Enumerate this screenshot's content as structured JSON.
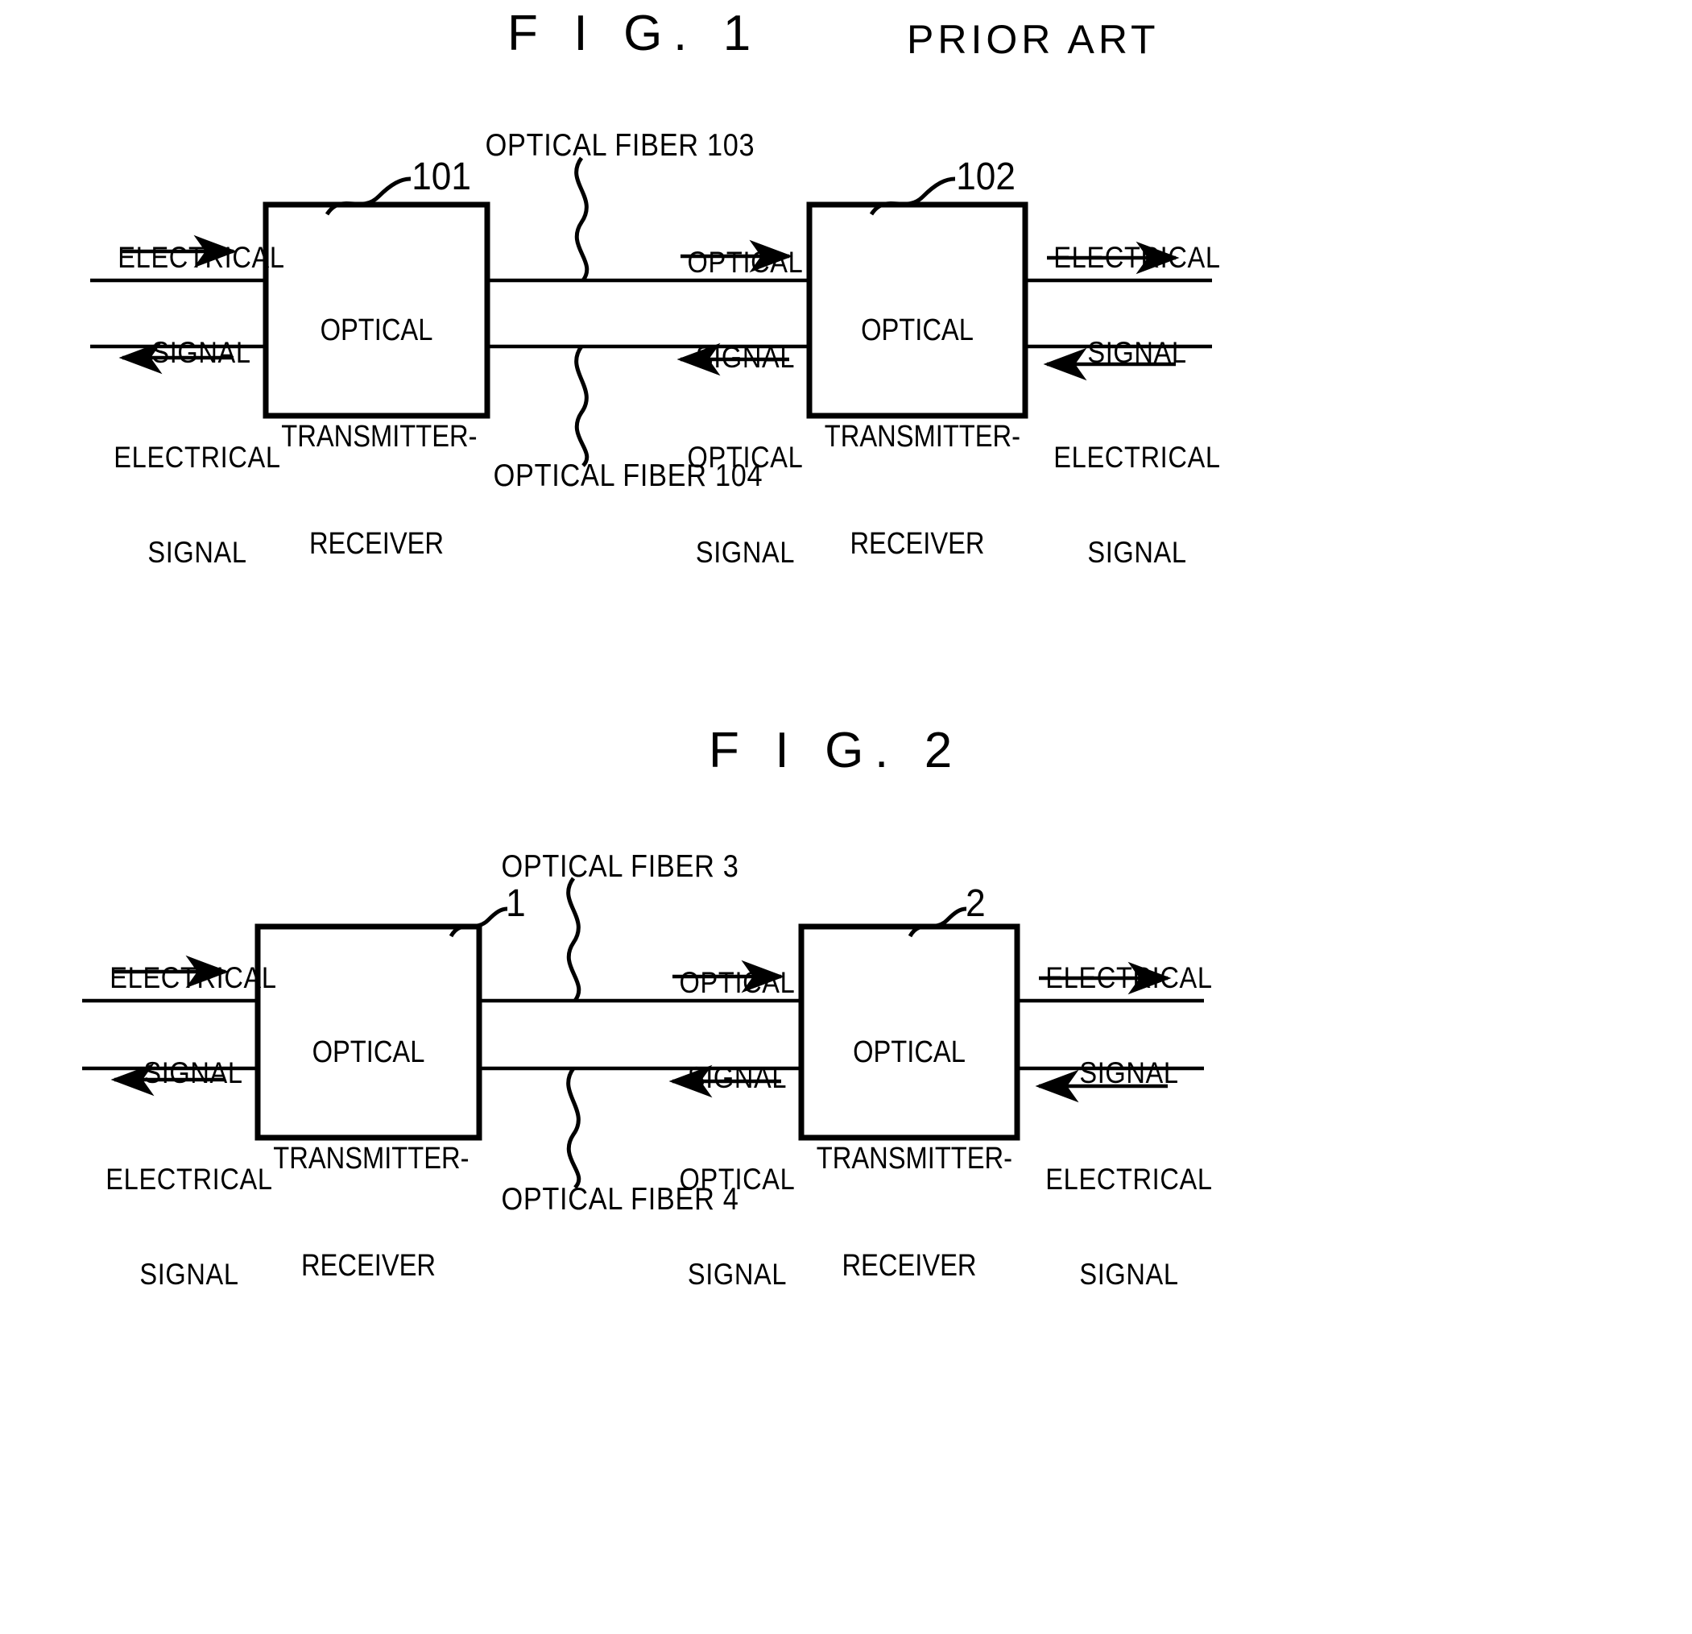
{
  "document": {
    "type": "patent-drawing-sheet",
    "background_color": "#ffffff",
    "ink_color": "#000000"
  },
  "figures": [
    {
      "id": "fig1",
      "title": "F I G. 1",
      "subtitle": "PRIOR ART",
      "left_block": {
        "label_line1": "OPTICAL",
        "label_line2": "TRANSMITTER-",
        "label_line3": "RECEIVER",
        "reference_numeral": "101"
      },
      "right_block": {
        "label_line1": "OPTICAL",
        "label_line2": "TRANSMITTER-",
        "label_line3": "RECEIVER",
        "reference_numeral": "102"
      },
      "fiber_top_label": "OPTICAL FIBER 103",
      "fiber_bottom_label": "OPTICAL FIBER 104",
      "signals": {
        "far_left_top_line1": "ELECTRICAL",
        "far_left_top_line2": "SIGNAL",
        "far_left_bottom_line1": "ELECTRICAL",
        "far_left_bottom_line2": "SIGNAL",
        "mid_top_line1": "OPTICAL",
        "mid_top_line2": "SIGNAL",
        "mid_bottom_line1": "OPTICAL",
        "mid_bottom_line2": "SIGNAL",
        "far_right_top_line1": "ELECTRICAL",
        "far_right_top_line2": "SIGNAL",
        "far_right_bottom_line1": "ELECTRICAL",
        "far_right_bottom_line2": "SIGNAL"
      }
    },
    {
      "id": "fig2",
      "title": "F I G. 2",
      "subtitle": "",
      "left_block": {
        "label_line1": "OPTICAL",
        "label_line2": "TRANSMITTER-",
        "label_line3": "RECEIVER",
        "reference_numeral": "1"
      },
      "right_block": {
        "label_line1": "OPTICAL",
        "label_line2": "TRANSMITTER-",
        "label_line3": "RECEIVER",
        "reference_numeral": "2"
      },
      "fiber_top_label": "OPTICAL FIBER 3",
      "fiber_bottom_label": "OPTICAL FIBER 4",
      "signals": {
        "far_left_top_line1": "ELECTRICAL",
        "far_left_top_line2": "SIGNAL",
        "far_left_bottom_line1": "ELECTRICAL",
        "far_left_bottom_line2": "SIGNAL",
        "mid_top_line1": "OPTICAL",
        "mid_top_line2": "SIGNAL",
        "mid_bottom_line1": "OPTICAL",
        "mid_bottom_line2": "SIGNAL",
        "far_right_top_line1": "ELECTRICAL",
        "far_right_top_line2": "SIGNAL",
        "far_right_bottom_line1": "ELECTRICAL",
        "far_right_bottom_line2": "SIGNAL"
      }
    }
  ]
}
